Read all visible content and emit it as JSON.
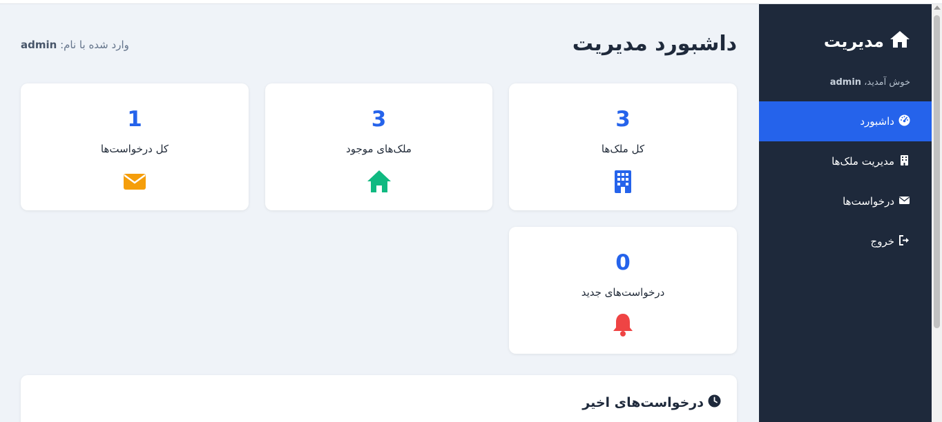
{
  "sidebar": {
    "brand": "مدیریت",
    "welcome_prefix": "خوش آمدید، ",
    "welcome_user": "admin",
    "items": [
      {
        "label": "داشبورد",
        "icon": "dashboard-icon",
        "active": true
      },
      {
        "label": "مدیریت ملک‌ها",
        "icon": "building-icon",
        "active": false
      },
      {
        "label": "درخواست‌ها",
        "icon": "envelope-icon",
        "active": false
      },
      {
        "label": "خروج",
        "icon": "logout-icon",
        "active": false
      }
    ]
  },
  "header": {
    "title": "داشبورد مدیریت",
    "logged_in_prefix": "وارد شده با نام: ",
    "logged_in_user": "admin"
  },
  "stats": [
    {
      "value": "3",
      "label": "کل ملک‌ها",
      "icon": "building-icon",
      "color": "#2563eb"
    },
    {
      "value": "3",
      "label": "ملک‌های موجود",
      "icon": "home-icon",
      "color": "#10b981"
    },
    {
      "value": "1",
      "label": "کل درخواست‌ها",
      "icon": "envelope-icon",
      "color": "#f59e0b"
    },
    {
      "value": "0",
      "label": "درخواست‌های جدید",
      "icon": "bell-icon",
      "color": "#ef4444"
    }
  ],
  "recent": {
    "title": "درخواست‌های اخیر",
    "icon": "clock-icon"
  },
  "colors": {
    "sidebar_bg": "#1e293b",
    "accent": "#2563eb",
    "page_bg": "#eff3f8"
  }
}
